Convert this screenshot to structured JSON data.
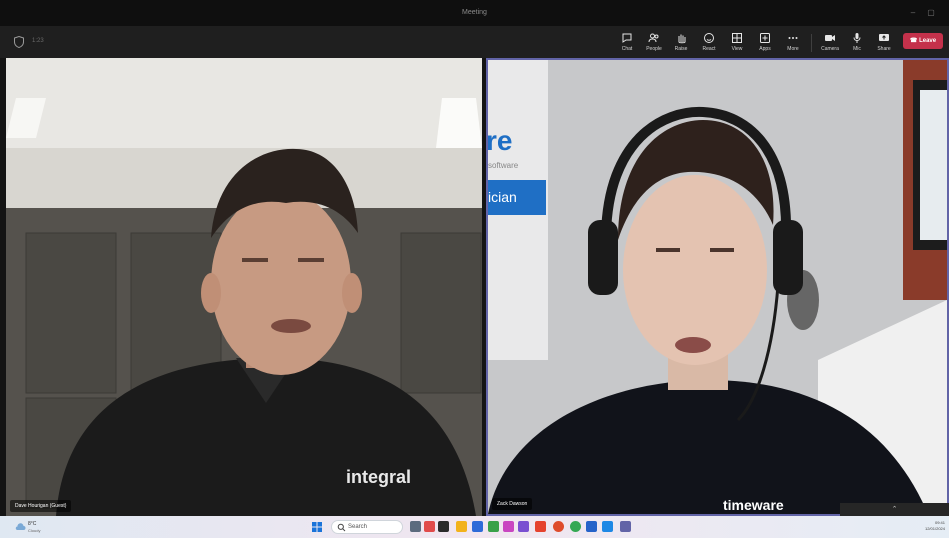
{
  "window": {
    "title": "Meeting"
  },
  "toolbar": {
    "timer": "1:23",
    "items": [
      {
        "label": "Chat",
        "icon": "chat-icon"
      },
      {
        "label": "People",
        "icon": "people-icon"
      },
      {
        "label": "Raise",
        "icon": "raise-hand-icon"
      },
      {
        "label": "React",
        "icon": "react-icon"
      },
      {
        "label": "View",
        "icon": "view-icon"
      },
      {
        "label": "Apps",
        "icon": "apps-icon"
      },
      {
        "label": "More",
        "icon": "more-icon"
      },
      {
        "label": "Camera",
        "icon": "camera-icon"
      },
      {
        "label": "Mic",
        "icon": "mic-icon"
      },
      {
        "label": "Share",
        "icon": "share-icon"
      }
    ],
    "leave_label": "Leave"
  },
  "participants": [
    {
      "name": "Dave Hourigan (Guest)",
      "shirt_logo": "integral"
    },
    {
      "name": "Zack Dawson",
      "shirt_logo": "timeware",
      "banner_text": "re",
      "banner_sub": "software",
      "banner_button": "ician"
    }
  ],
  "taskbar": {
    "weather_temp": "8°C",
    "weather_desc": "Cloudy",
    "search_placeholder": "Search",
    "clock_time": "09:41",
    "clock_date": "12/01/2024"
  },
  "colors": {
    "accent": "#6264a7",
    "leave": "#c4314b",
    "banner_blue": "#1f6fc5"
  }
}
